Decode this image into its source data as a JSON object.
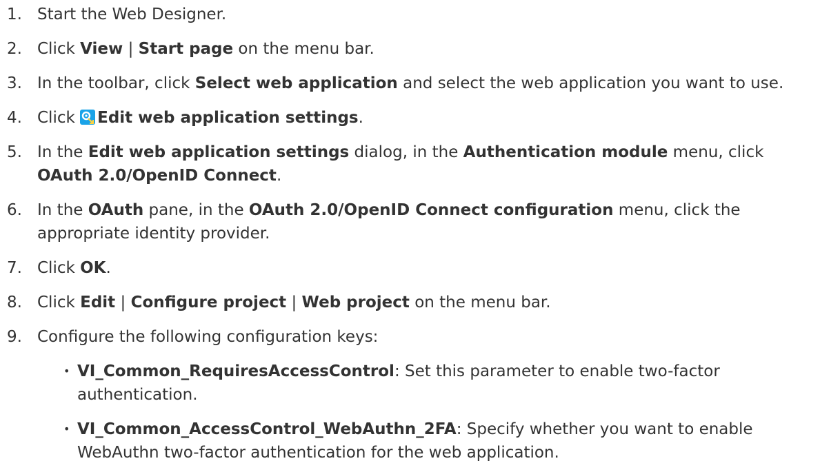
{
  "steps": [
    {
      "num": "1.",
      "parts": [
        {
          "t": "Start the Web Designer.",
          "b": false
        }
      ]
    },
    {
      "num": "2.",
      "parts": [
        {
          "t": "Click ",
          "b": false
        },
        {
          "t": "View",
          "b": true
        },
        {
          "t": " | ",
          "b": false
        },
        {
          "t": "Start page",
          "b": true
        },
        {
          "t": " on the menu bar.",
          "b": false
        }
      ]
    },
    {
      "num": "3.",
      "parts": [
        {
          "t": "In the toolbar, click ",
          "b": false
        },
        {
          "t": "Select web application",
          "b": true
        },
        {
          "t": " and select the web application you want to use.",
          "b": false
        }
      ]
    },
    {
      "num": "4.",
      "parts": [
        {
          "t": "Click ",
          "b": false
        },
        {
          "icon": "edit-web-application-settings-icon"
        },
        {
          "t": "Edit web application settings",
          "b": true
        },
        {
          "t": ".",
          "b": false
        }
      ]
    },
    {
      "num": "5.",
      "parts": [
        {
          "t": "In the ",
          "b": false
        },
        {
          "t": "Edit web application settings",
          "b": true
        },
        {
          "t": " dialog, in the ",
          "b": false
        },
        {
          "t": "Authentication module",
          "b": true
        },
        {
          "t": " menu, click ",
          "b": false
        },
        {
          "t": "OAuth 2.0/OpenID Connect",
          "b": true
        },
        {
          "t": ".",
          "b": false
        }
      ]
    },
    {
      "num": "6.",
      "parts": [
        {
          "t": "In the ",
          "b": false
        },
        {
          "t": "OAuth",
          "b": true
        },
        {
          "t": " pane, in the ",
          "b": false
        },
        {
          "t": "OAuth 2.0/OpenID Connect configuration",
          "b": true
        },
        {
          "t": " menu, click the appropriate identity provider.",
          "b": false
        }
      ]
    },
    {
      "num": "7.",
      "parts": [
        {
          "t": "Click ",
          "b": false
        },
        {
          "t": "OK",
          "b": true
        },
        {
          "t": ".",
          "b": false
        }
      ]
    },
    {
      "num": "8.",
      "parts": [
        {
          "t": "Click ",
          "b": false
        },
        {
          "t": "Edit",
          "b": true
        },
        {
          "t": " | ",
          "b": false
        },
        {
          "t": "Configure project",
          "b": true
        },
        {
          "t": " | ",
          "b": false
        },
        {
          "t": "Web project",
          "b": true
        },
        {
          "t": " on the menu bar.",
          "b": false
        }
      ]
    },
    {
      "num": "9.",
      "parts": [
        {
          "t": "Configure the following configuration keys:",
          "b": false
        }
      ],
      "sub": [
        {
          "parts": [
            {
              "t": "VI_Common_RequiresAccessControl",
              "b": true
            },
            {
              "t": ": Set this parameter to enable two-factor authentication.",
              "b": false
            }
          ]
        },
        {
          "parts": [
            {
              "t": "VI_Common_AccessControl_WebAuthn_2FA",
              "b": true
            },
            {
              "t": ": Specify whether you want to enable WebAuthn two-factor authentication for the web application.",
              "b": false
            }
          ]
        }
      ]
    }
  ],
  "bullet_glyph": "•",
  "colors": {
    "text": "#333333",
    "icon_bg": "#1aa3e8",
    "icon_gear": "#ffffff"
  }
}
